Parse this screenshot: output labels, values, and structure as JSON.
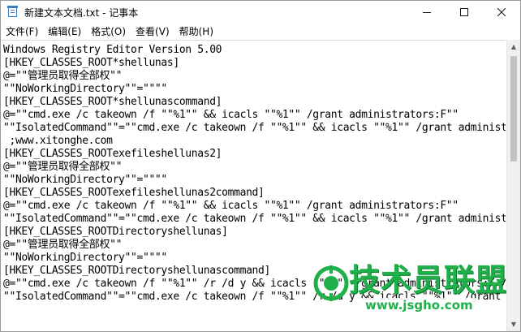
{
  "window": {
    "title": "新建文本文档.txt - 记事本",
    "controls": [
      "minimize",
      "maximize",
      "close"
    ]
  },
  "menu": [
    {
      "label": "文件(F)"
    },
    {
      "label": "编辑(E)"
    },
    {
      "label": "格式(O)"
    },
    {
      "label": "查看(V)"
    },
    {
      "label": "帮助(H)"
    }
  ],
  "editor": {
    "lines": [
      "Windows Registry Editor Version 5.00",
      "[HKEY_CLASSES_ROOT*shellunas]",
      "@=\"\"管理员取得全部权\"\"",
      "\"\"NoWorkingDirectory\"\"=\"\"\"\"",
      "[HKEY_CLASSES_ROOT*shellunascommand]",
      "@=\"\"cmd.exe /c takeown /f \"\"%1\"\" && icacls \"\"%1\"\" /grant administrators:F\"\"",
      "\"\"IsolatedCommand\"\"=\"\"cmd.exe /c takeown /f \"\"%1\"\" && icacls \"\"%1\"\" /grant administrators:F\"\"",
      " ;www.xitonghe.com",
      "[HKEY_CLASSES_ROOTexefileshellunas2]",
      "@=\"\"管理员取得全部权\"\"",
      "\"\"NoWorkingDirectory\"\"=\"\"\"\"",
      "[HKEY_CLASSES_ROOTexefileshellunas2command]",
      "@=\"\"cmd.exe /c takeown /f \"\"%1\"\" && icacls \"\"%1\"\" /grant administrators:F\"\"",
      "\"\"IsolatedCommand\"\"=\"\"cmd.exe /c takeown /f \"\"%1\"\" && icacls \"\"%1\"\" /grant administrators:F\"\"",
      "[HKEY_CLASSES_ROOTDirectoryshellunas]",
      "@=\"\"管理员取得全部权\"\"",
      "\"\"NoWorkingDirectory\"\"=\"\"\"\"",
      "[HKEY_CLASSES_ROOTDirectoryshellunascommand]",
      "@=\"\"cmd.exe /c takeown /f \"\"%1\"\" /r /d y && icacls \"\"%1\"\" /grant administrators:F /t\"\"",
      "\"\"IsolatedCommand\"\"=\"\"cmd.exe /c takeown /f \"\"%1\"\" /r /d y && icacls \"\"%1\"\" /grant administrators:F /t\"\""
    ]
  },
  "watermark": {
    "brand": "技术员联盟",
    "url": "www.jsgho.com"
  },
  "colors": {
    "watermark_green": "#1fb04a"
  }
}
